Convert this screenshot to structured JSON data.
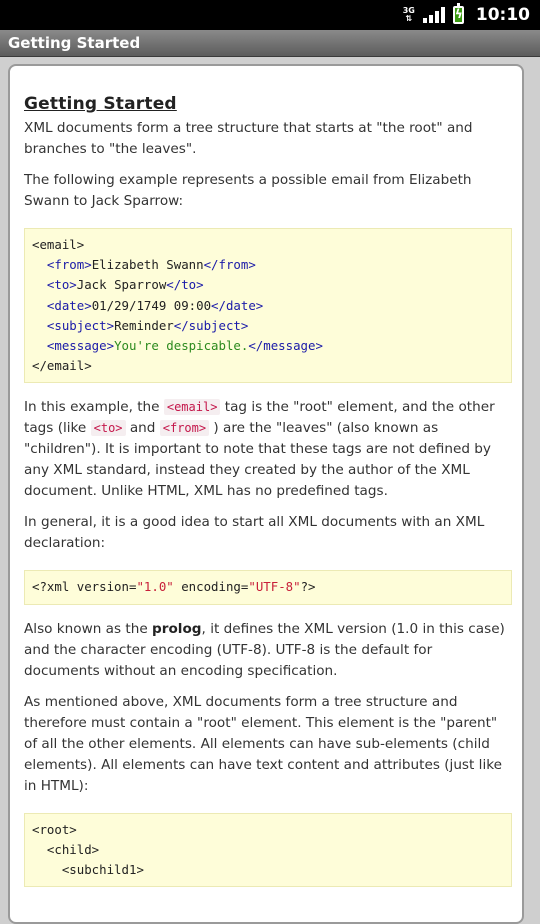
{
  "status": {
    "network": "3G",
    "time": "10:10"
  },
  "titlebar": {
    "title": "Getting Started"
  },
  "page": {
    "heading": "Getting Started",
    "p1": "XML documents form a tree structure that starts at \"the root\" and branches to \"the leaves\".",
    "p2": "The following example represents a possible email from Elizabeth Swann to Jack Sparrow:",
    "code1": {
      "l1": "<email>",
      "l2_open": "<from>",
      "l2_text": "Elizabeth Swann",
      "l2_close": "</from>",
      "l3_open": "<to>",
      "l3_text": "Jack Sparrow",
      "l3_close": "</to>",
      "l4_open": "<date>",
      "l4_text": "01/29/1749 09:00",
      "l4_close": "</date>",
      "l5_open": "<subject>",
      "l5_text": "Reminder",
      "l5_close": "</subject>",
      "l6_open": "<message>",
      "l6_text": "You're despicable.",
      "l6_close": "</message>",
      "l7": "</email>"
    },
    "p3": {
      "a": "In this example, the ",
      "code_email": "<email>",
      "b": " tag is the \"root\" element, and the other tags (like ",
      "code_to": "<to>",
      "c": " and ",
      "code_from": "<from>",
      "d": " ) are the \"leaves\" (also known as \"children\"). It is important to note that these tags are not defined by any XML standard, instead they created by the author of the XML document. Unlike HTML, XML has no predefined tags."
    },
    "p4": "In general, it is a good idea to start all XML documents with an XML declaration:",
    "code2": {
      "a": "<?xml version=",
      "v1": "\"1.0\"",
      "b": " encoding=",
      "v2": "\"UTF-8\"",
      "c": "?>"
    },
    "p5": {
      "a": "Also known as the ",
      "bold": "prolog",
      "b": ", it defines the XML version (1.0 in this case) and the character encoding (UTF-8). UTF-8 is the default for documents without an encoding specification."
    },
    "p6": "As mentioned above, XML documents form a tree structure and therefore must contain a \"root\" element. This element is the \"parent\" of all the other elements. All elements can have sub-elements (child elements). All elements can have text content and attributes (just like in HTML):",
    "code3": {
      "l1": "<root>",
      "l2": "<child>",
      "l3": "<subchild1>"
    }
  }
}
